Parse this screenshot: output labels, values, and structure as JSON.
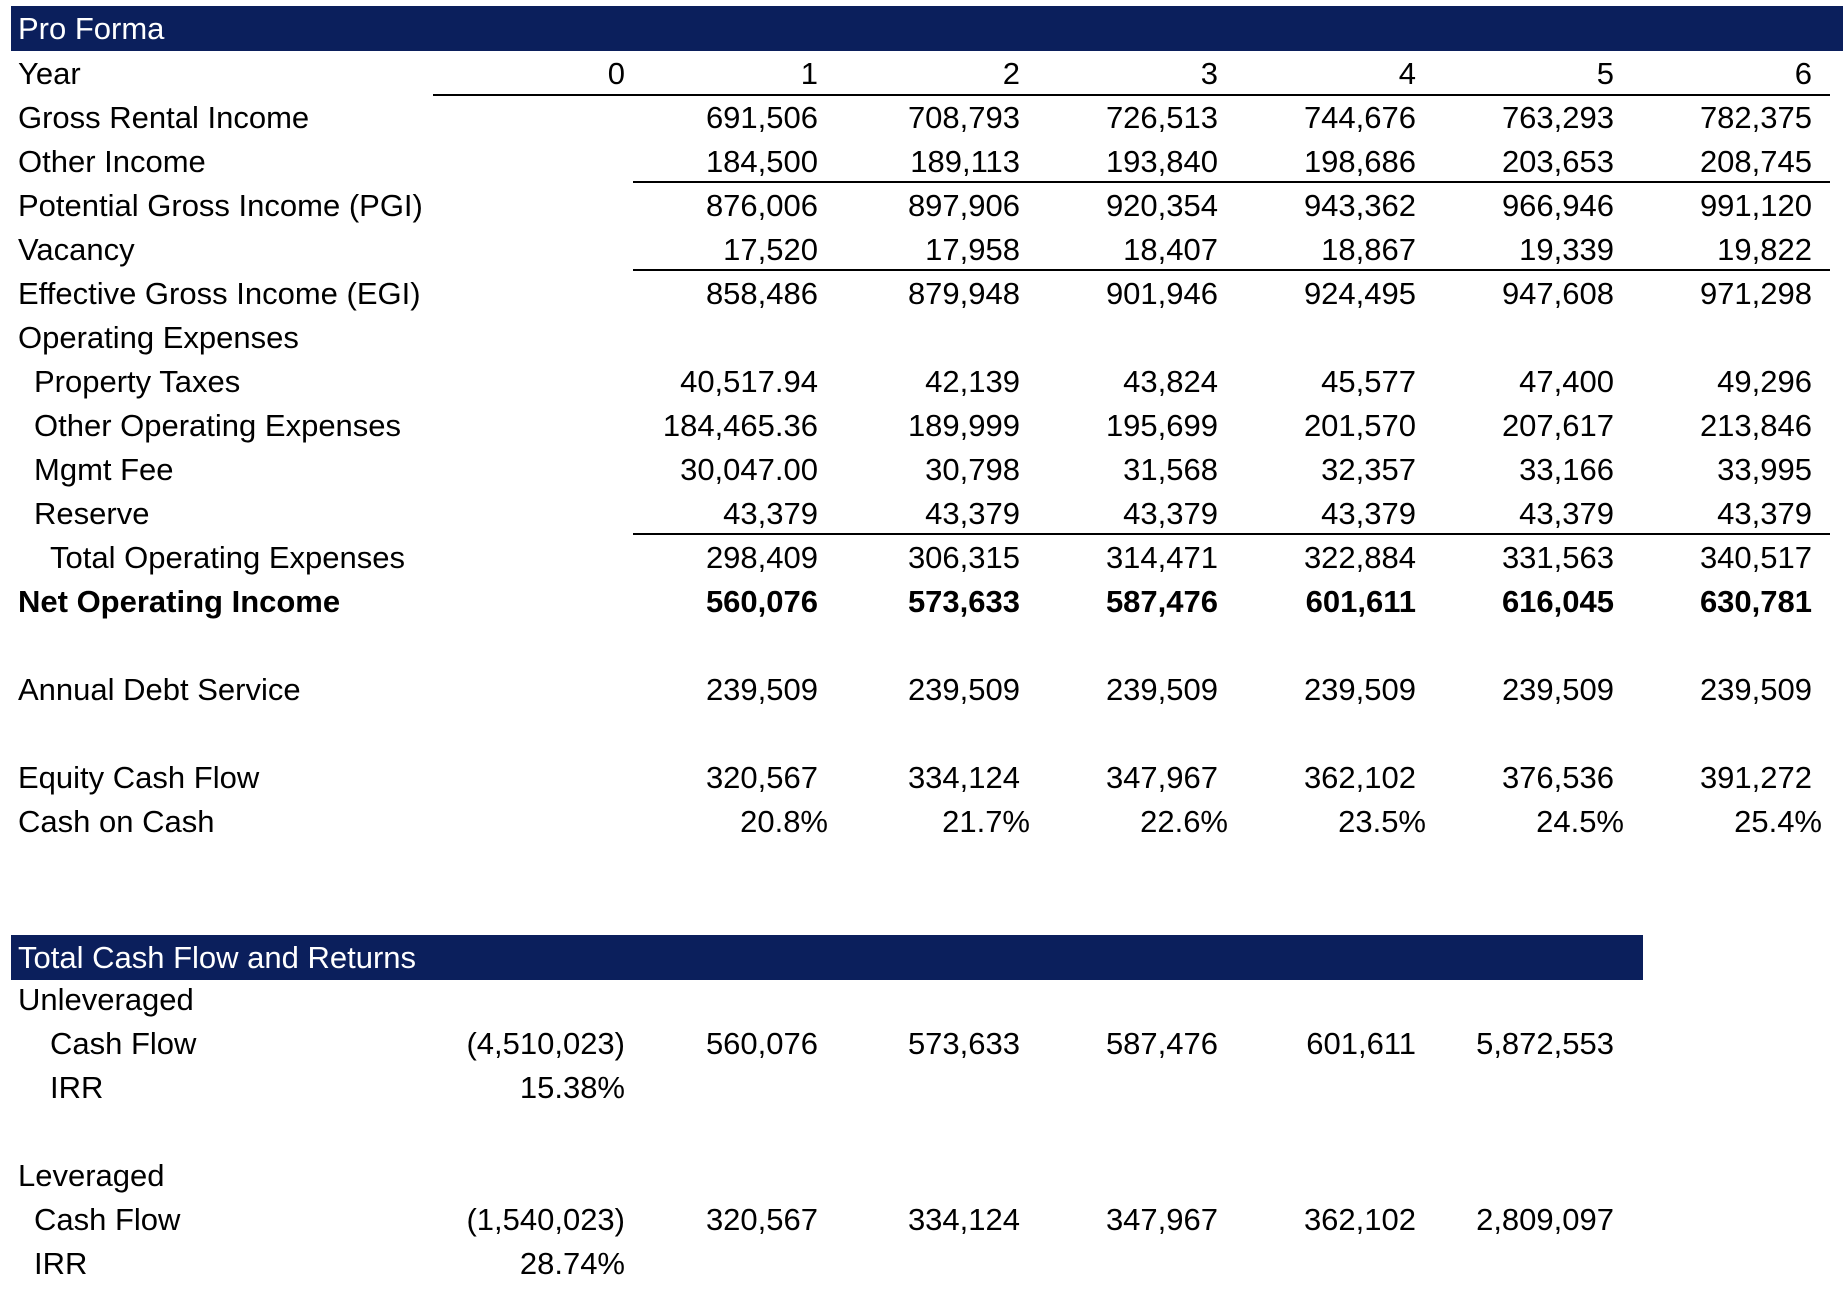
{
  "pro_forma": {
    "title": "Pro Forma",
    "year_label": "Year",
    "years": [
      "0",
      "1",
      "2",
      "3",
      "4",
      "5",
      "6"
    ],
    "rows": [
      {
        "label": "Gross Rental Income",
        "values": [
          "",
          "691,506",
          "708,793",
          "726,513",
          "744,676",
          "763,293",
          "782,375"
        ]
      },
      {
        "label": "Other Income",
        "values": [
          "",
          "184,500",
          "189,113",
          "193,840",
          "198,686",
          "203,653",
          "208,745"
        ]
      },
      {
        "label": "Potential Gross Income (PGI)",
        "values": [
          "",
          "876,006",
          "897,906",
          "920,354",
          "943,362",
          "966,946",
          "991,120"
        ]
      },
      {
        "label": "Vacancy",
        "values": [
          "",
          "17,520",
          "17,958",
          "18,407",
          "18,867",
          "19,339",
          "19,822"
        ]
      },
      {
        "label": "Effective Gross Income (EGI)",
        "values": [
          "",
          "858,486",
          "879,948",
          "901,946",
          "924,495",
          "947,608",
          "971,298"
        ]
      },
      {
        "label": "Operating Expenses",
        "values": [
          "",
          "",
          "",
          "",
          "",
          "",
          ""
        ]
      },
      {
        "label": "Property Taxes",
        "values": [
          "",
          "40,517.94",
          "42,139",
          "43,824",
          "45,577",
          "47,400",
          "49,296"
        ]
      },
      {
        "label": "Other Operating Expenses",
        "values": [
          "",
          "184,465.36",
          "189,999",
          "195,699",
          "201,570",
          "207,617",
          "213,846"
        ]
      },
      {
        "label": "Mgmt Fee",
        "values": [
          "",
          "30,047.00",
          "30,798",
          "31,568",
          "32,357",
          "33,166",
          "33,995"
        ]
      },
      {
        "label": "Reserve",
        "values": [
          "",
          "43,379",
          "43,379",
          "43,379",
          "43,379",
          "43,379",
          "43,379"
        ]
      },
      {
        "label": "Total Operating Expenses",
        "values": [
          "",
          "298,409",
          "306,315",
          "314,471",
          "322,884",
          "331,563",
          "340,517"
        ]
      },
      {
        "label": "Net Operating Income",
        "values": [
          "",
          "560,076",
          "573,633",
          "587,476",
          "601,611",
          "616,045",
          "630,781"
        ]
      },
      {
        "label": "Annual Debt Service",
        "values": [
          "",
          "239,509",
          "239,509",
          "239,509",
          "239,509",
          "239,509",
          "239,509"
        ]
      },
      {
        "label": "Equity Cash Flow",
        "values": [
          "",
          "320,567",
          "334,124",
          "347,967",
          "362,102",
          "376,536",
          "391,272"
        ]
      },
      {
        "label": "Cash on Cash",
        "values": [
          "",
          "20.8%",
          "21.7%",
          "22.6%",
          "23.5%",
          "24.5%",
          "25.4%"
        ]
      }
    ]
  },
  "returns": {
    "title": "Total Cash Flow and Returns",
    "unleveraged": {
      "label": "Unleveraged",
      "cash_flow_label": "Cash Flow",
      "cash_flow": [
        "(4,510,023)",
        "560,076",
        "573,633",
        "587,476",
        "601,611",
        "5,872,553"
      ],
      "irr_label": "IRR",
      "irr": "15.38%"
    },
    "leveraged": {
      "label": "Leveraged",
      "cash_flow_label": "Cash Flow",
      "cash_flow": [
        "(1,540,023)",
        "320,567",
        "334,124",
        "347,967",
        "362,102",
        "2,809,097"
      ],
      "irr_label": "IRR",
      "irr": "28.74%"
    }
  }
}
